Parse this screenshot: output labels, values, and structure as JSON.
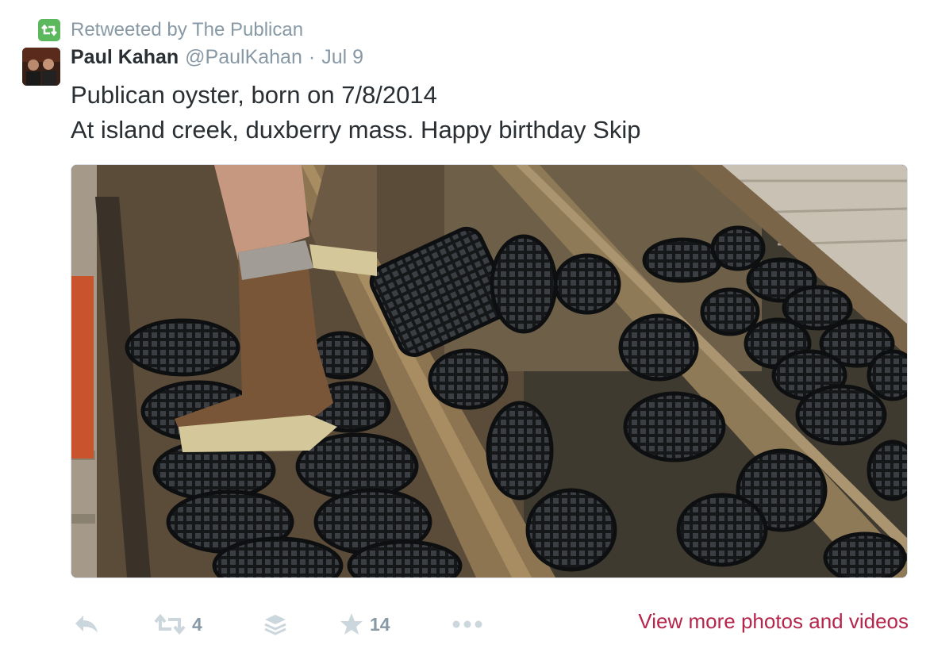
{
  "retweet_context": {
    "text": "Retweeted by The Publican",
    "icon": "retweet-icon",
    "accent_color": "#5cb85c"
  },
  "tweet": {
    "fullname": "Paul Kahan",
    "username": "@PaulKahan",
    "separator": "·",
    "time": "Jul 9",
    "text_lines": [
      "Publican oyster, born on 7/8/2014",
      "At island creek, duxberry mass. Happy birthday Skip"
    ]
  },
  "actions": {
    "reply_icon": "reply-icon",
    "retweet_icon": "retweet-icon",
    "retweet_count": "4",
    "stack_icon": "stack-icon",
    "favorite_icon": "star-icon",
    "favorite_count": "14",
    "more_icon": "more-dots-icon",
    "view_more_label": "View more photos and videos",
    "link_color": "#b6254b",
    "muted_color": "#8899a6"
  }
}
